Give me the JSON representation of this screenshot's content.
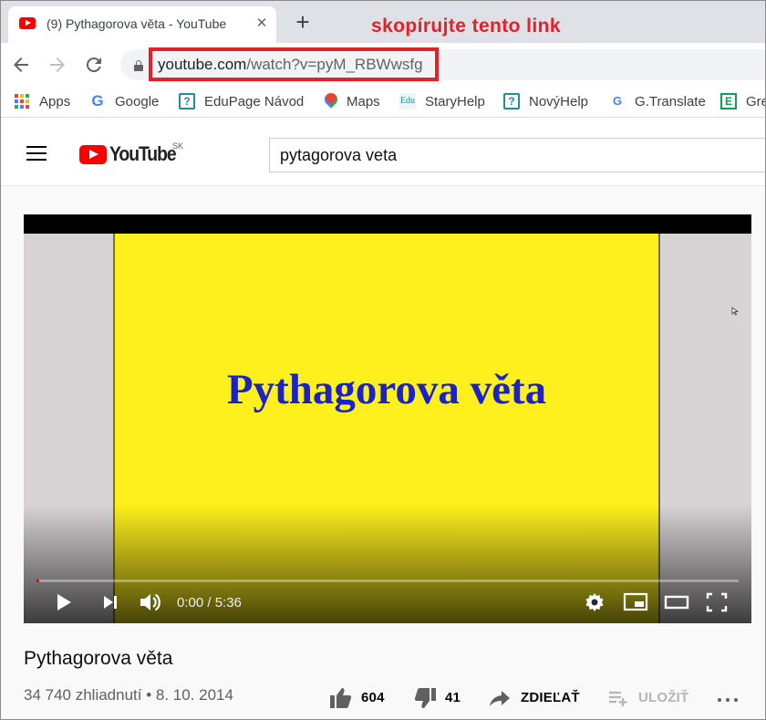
{
  "browser": {
    "tab": {
      "title": "(9) Pythagorova věta - YouTube",
      "close": "✕"
    },
    "new_tab": "+",
    "annotation": "skopírujte tento link",
    "url": {
      "host": "youtube.com",
      "path": "/watch?v=pyM_RBWwsfg"
    },
    "bookmarks": [
      {
        "label": "Apps",
        "icon": "apps-icon"
      },
      {
        "label": "Google",
        "icon": "google-icon"
      },
      {
        "label": "EduPage Návod",
        "icon": "help-icon"
      },
      {
        "label": "Maps",
        "icon": "maps-icon"
      },
      {
        "label": "StaryHelp",
        "icon": "edu-icon"
      },
      {
        "label": "NovýHelp",
        "icon": "help-icon"
      },
      {
        "label": "G.Translate",
        "icon": "translate-icon"
      },
      {
        "label": "Gre",
        "icon": "e-icon"
      }
    ]
  },
  "youtube": {
    "wordmark": "YouTube",
    "country": "SK",
    "search_value": "pytagorova veta"
  },
  "video": {
    "slide_title": "Pythagorova věta",
    "time": "0:00 / 5:36",
    "progress": 0.0,
    "title": "Pythagorova věta",
    "meta": "34 740 zhliadnutí • 8. 10. 2014",
    "likes": "604",
    "dislikes": "41",
    "share_label": "ZDIEĽAŤ",
    "save_label": "ULOŽIŤ"
  },
  "colors": {
    "annotation_red": "#e4202a",
    "youtube_red": "#ff0000",
    "slide_yellow": "#fdf01c",
    "slide_text_blue": "#1a22c8"
  }
}
